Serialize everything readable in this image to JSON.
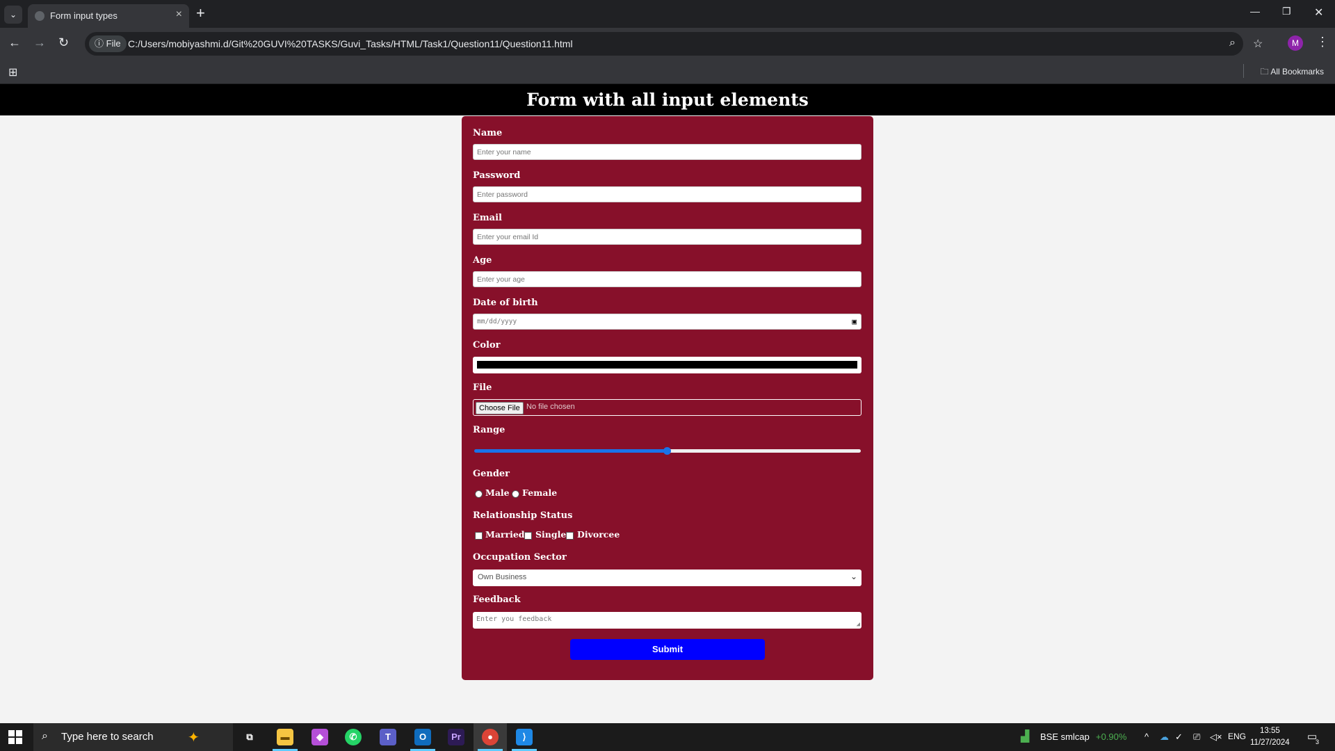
{
  "browser": {
    "tab_title": "Form input types",
    "url_chip": "File",
    "url": "C:/Users/mobiyashmi.d/Git%20GUVI%20TASKS/Guvi_Tasks/HTML/Task1/Question11/Question11.html",
    "all_bookmarks": "All Bookmarks",
    "profile_initial": "M"
  },
  "page": {
    "heading": "Form with all input elements"
  },
  "form": {
    "name": {
      "label": "Name",
      "placeholder": "Enter your name"
    },
    "password": {
      "label": "Password",
      "placeholder": "Enter password"
    },
    "email": {
      "label": "Email",
      "placeholder": "Enter your email Id"
    },
    "age": {
      "label": "Age",
      "placeholder": "Enter your age"
    },
    "dob": {
      "label": "Date of birth",
      "placeholder": "mm/dd/yyyy"
    },
    "color": {
      "label": "Color",
      "value": "#000000"
    },
    "file": {
      "label": "File",
      "button": "Choose File",
      "status": "No file chosen"
    },
    "range": {
      "label": "Range",
      "value_fraction": 0.5
    },
    "gender": {
      "label": "Gender",
      "options": [
        "Male",
        "Female"
      ]
    },
    "relationship": {
      "label": "Relationship Status",
      "options": [
        "Married",
        "Single",
        "Divorcee"
      ]
    },
    "occupation": {
      "label": "Occupation Sector",
      "selected": "Own Business"
    },
    "feedback": {
      "label": "Feedback",
      "placeholder": "Enter you feedback"
    },
    "submit": "Submit"
  },
  "taskbar": {
    "search_placeholder": "Type here to search",
    "stock_name": "BSE smlcap",
    "stock_change": "+0.90%",
    "language": "ENG",
    "time": "13:55",
    "date": "11/27/2024",
    "notification_count": "3"
  },
  "colors": {
    "form_bg": "#87102a",
    "header_bg": "#000000",
    "submit_bg": "#0000ff",
    "range_accent": "#1a73e8"
  }
}
